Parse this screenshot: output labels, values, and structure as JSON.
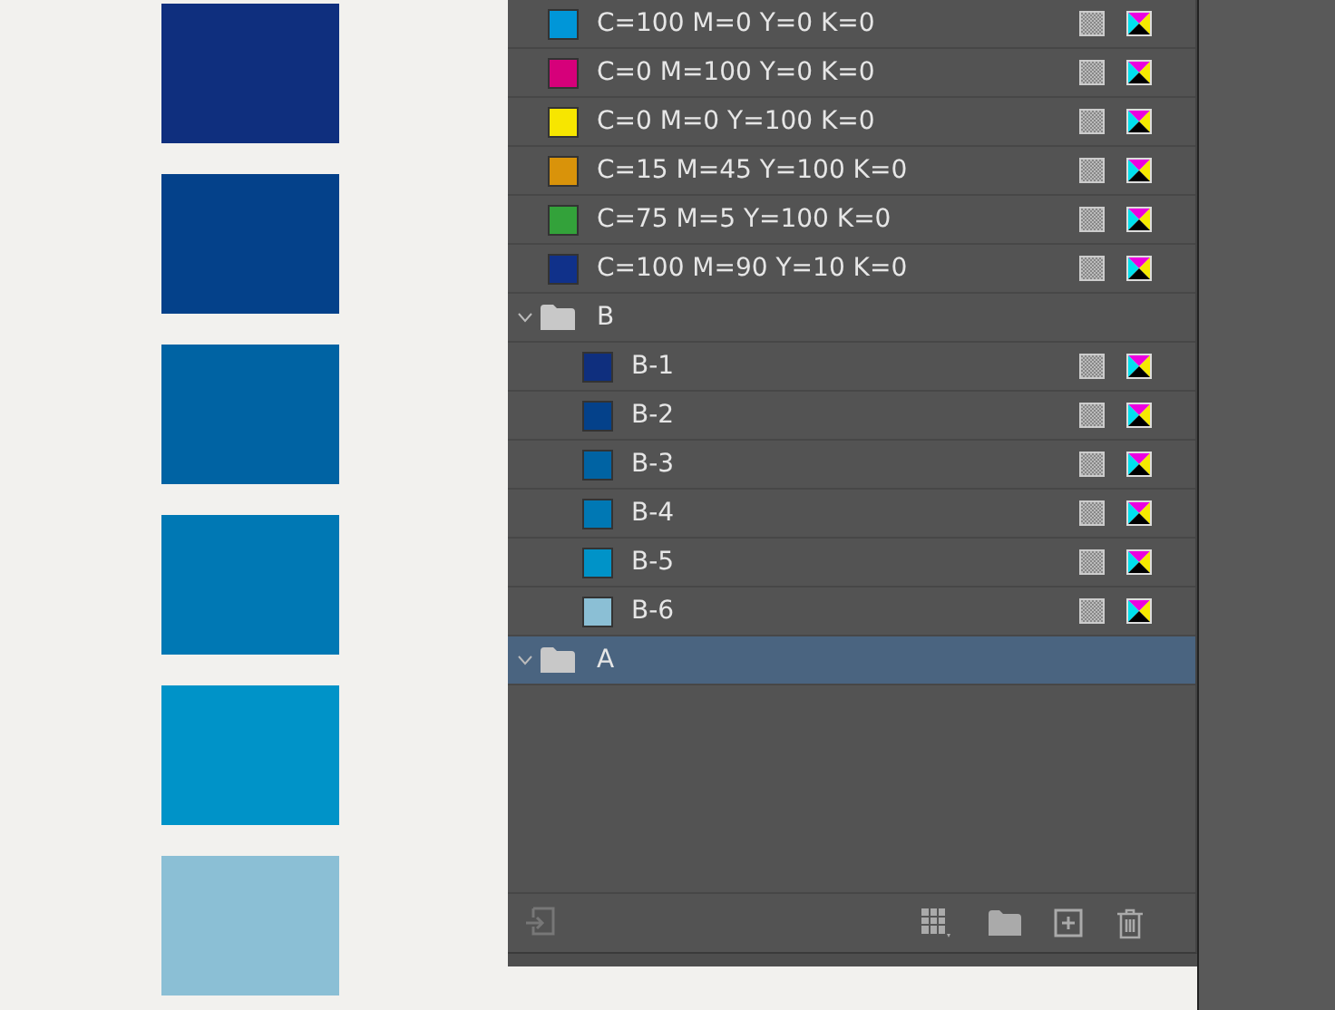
{
  "canvas": {
    "shapes": [
      {
        "color": "#0f2f7e"
      },
      {
        "color": "#04418a"
      },
      {
        "color": "#0063a3"
      },
      {
        "color": "#0078b4"
      },
      {
        "color": "#0093c8"
      },
      {
        "color": "#8bbfd5"
      }
    ]
  },
  "swatches_panel": {
    "items": [
      {
        "kind": "swatch",
        "name": "C=100 M=0 Y=0 K=0",
        "color": "#0096d8",
        "selected": false
      },
      {
        "kind": "swatch",
        "name": "C=0 M=100 Y=0 K=0",
        "color": "#d6007a",
        "selected": false
      },
      {
        "kind": "swatch",
        "name": "C=0 M=0 Y=100 K=0",
        "color": "#f7e600",
        "selected": false
      },
      {
        "kind": "swatch",
        "name": "C=15 M=45 Y=100 K=0",
        "color": "#d9930a",
        "selected": false
      },
      {
        "kind": "swatch",
        "name": "C=75 M=5 Y=100 K=0",
        "color": "#33a23a",
        "selected": false
      },
      {
        "kind": "swatch",
        "name": "C=100 M=90 Y=10 K=0",
        "color": "#10318a",
        "selected": false
      },
      {
        "kind": "folder",
        "name": "B",
        "expanded": true,
        "selected": false,
        "children": [
          {
            "kind": "swatch",
            "name": "B-1",
            "color": "#0f2f7e",
            "selected": false
          },
          {
            "kind": "swatch",
            "name": "B-2",
            "color": "#04418a",
            "selected": false
          },
          {
            "kind": "swatch",
            "name": "B-3",
            "color": "#0063a3",
            "selected": false
          },
          {
            "kind": "swatch",
            "name": "B-4",
            "color": "#0078b4",
            "selected": false
          },
          {
            "kind": "swatch",
            "name": "B-5",
            "color": "#0093c8",
            "selected": false
          },
          {
            "kind": "swatch",
            "name": "B-6",
            "color": "#8bbfd5",
            "selected": false
          }
        ]
      },
      {
        "kind": "folder",
        "name": "A",
        "expanded": true,
        "selected": true
      }
    ]
  }
}
